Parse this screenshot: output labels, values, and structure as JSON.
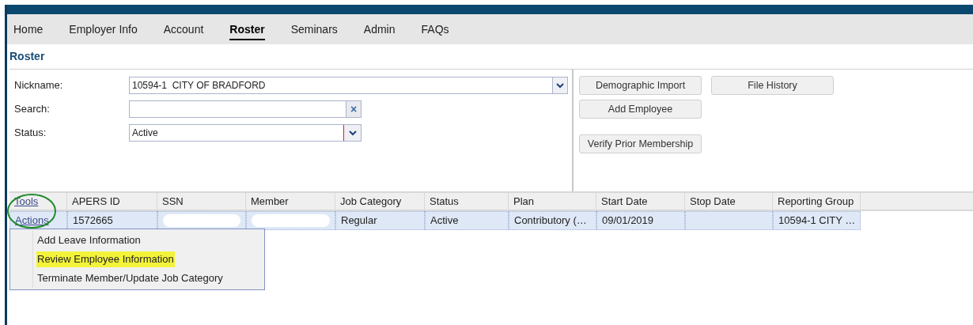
{
  "nav": [
    {
      "label": "Home",
      "selected": false
    },
    {
      "label": "Employer Info",
      "selected": false
    },
    {
      "label": "Account",
      "selected": false
    },
    {
      "label": "Roster",
      "selected": true
    },
    {
      "label": "Seminars",
      "selected": false
    },
    {
      "label": "Admin",
      "selected": false
    },
    {
      "label": "FAQs",
      "selected": false
    }
  ],
  "page_title": "Roster",
  "form": {
    "nickname": {
      "label": "Nickname:",
      "value": "10594-1  CITY OF BRADFORD"
    },
    "search": {
      "label": "Search:",
      "clear": "×"
    },
    "status": {
      "label": "Status:",
      "value": "Active"
    }
  },
  "button_rows": [
    [
      "Demographic Import",
      "File History"
    ],
    [
      "Add Employee"
    ],
    [
      "Verify Prior Membership"
    ]
  ],
  "table": {
    "columns": [
      "Tools",
      "APERS ID",
      "SSN",
      "Member",
      "Job Category",
      "Status",
      "Plan",
      "Start Date",
      "Stop Date",
      "Reporting Group"
    ],
    "rows": [
      {
        "cells": [
          {
            "kind": "link",
            "text": "Actions"
          },
          {
            "kind": "text",
            "text": "1572665"
          },
          {
            "kind": "redacted"
          },
          {
            "kind": "redacted"
          },
          {
            "kind": "text",
            "text": "Regular"
          },
          {
            "kind": "text",
            "text": "Active"
          },
          {
            "kind": "text",
            "text": "Contributory (…"
          },
          {
            "kind": "text",
            "text": "09/01/2019"
          },
          {
            "kind": "empty"
          },
          {
            "kind": "text",
            "text": "10594-1 CITY …"
          }
        ]
      }
    ]
  },
  "menu": [
    {
      "label": "Add Leave Information",
      "highlighted": false
    },
    {
      "label": "Review Employee Information",
      "highlighted": true
    },
    {
      "label": "Terminate Member/Update Job Category",
      "highlighted": false
    }
  ]
}
